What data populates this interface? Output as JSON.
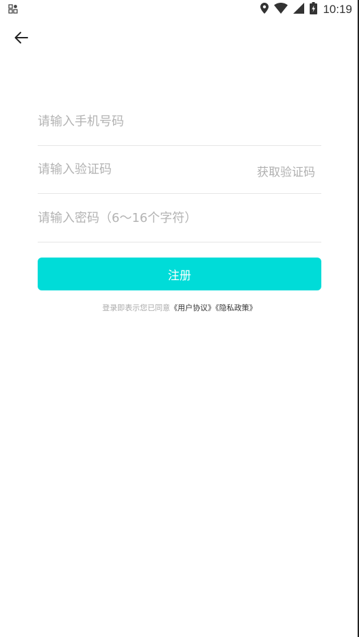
{
  "status_bar": {
    "time": "10:19",
    "icons": [
      "app-grid-icon",
      "location-icon",
      "wifi-icon",
      "signal-icon",
      "battery-icon"
    ]
  },
  "nav": {
    "back_icon": "arrow-left-icon"
  },
  "form": {
    "phone_placeholder": "请输入手机号码",
    "code_placeholder": "请输入验证码",
    "get_code_label": "获取验证码",
    "password_placeholder": "请输入密码（6～16个字符）",
    "submit_label": "注册"
  },
  "agreement": {
    "prefix": "登录即表示您已同意",
    "user_agreement": "《用户协议》",
    "privacy_policy": "《隐私政策》"
  },
  "colors": {
    "accent": "#00dcd8",
    "placeholder": "#b3b3b3",
    "divider": "#e6e6e6"
  }
}
